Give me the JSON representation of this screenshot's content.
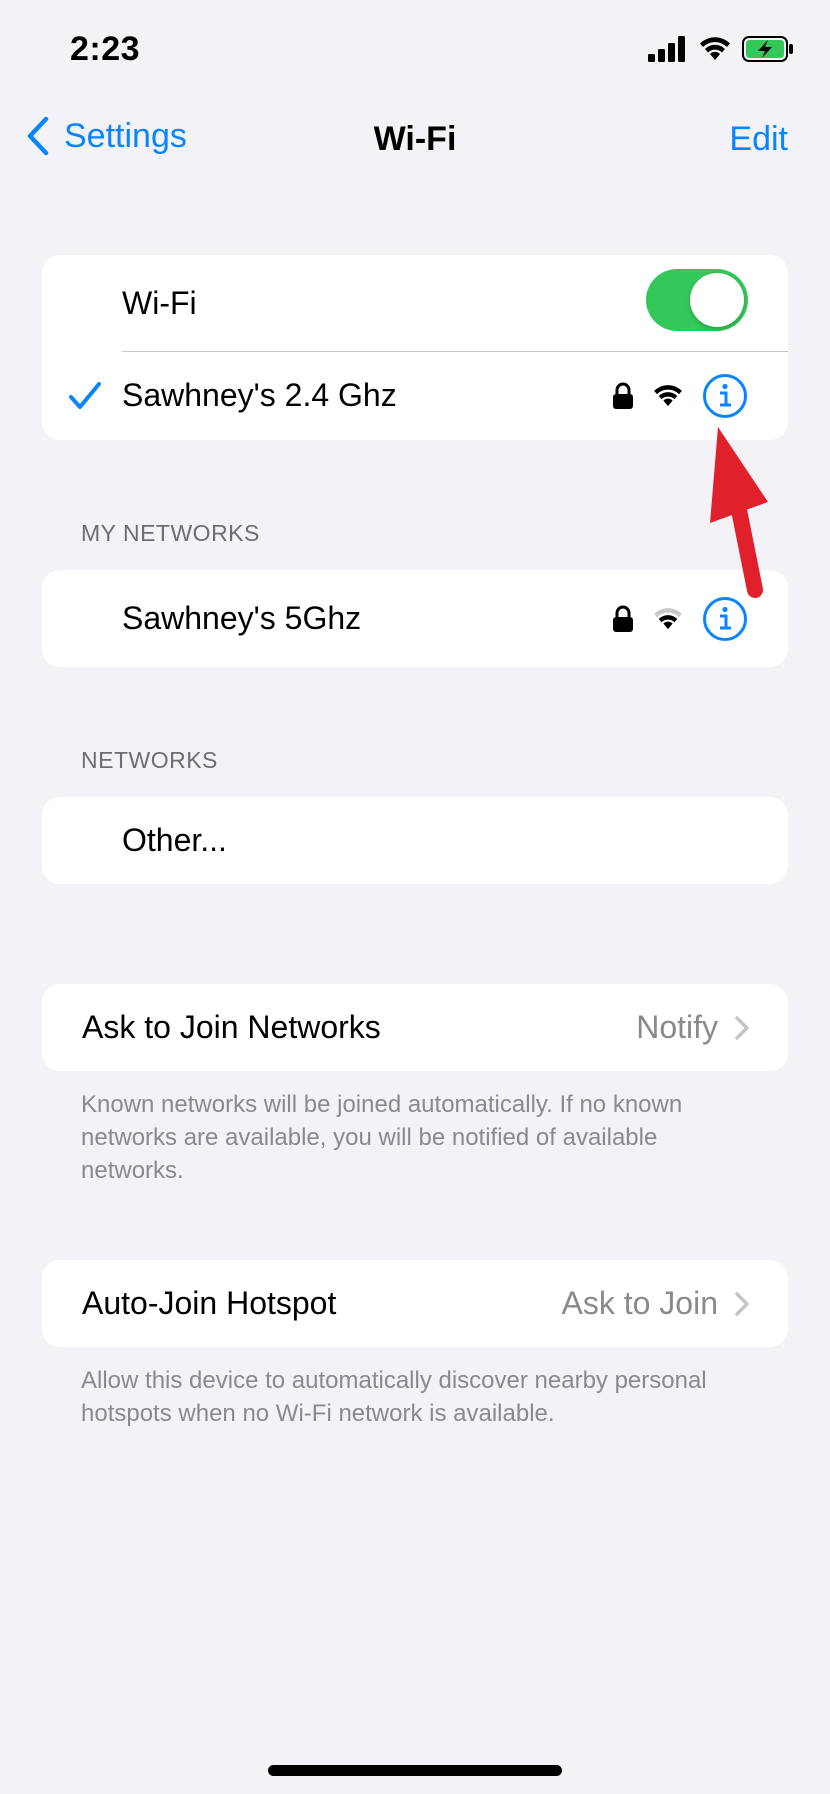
{
  "status_bar": {
    "time": "2:23"
  },
  "nav": {
    "back_label": "Settings",
    "title": "Wi-Fi",
    "edit_label": "Edit"
  },
  "wifi_toggle": {
    "label": "Wi-Fi",
    "on": true
  },
  "connected_network": {
    "name": "Sawhney's 2.4 Ghz"
  },
  "my_networks": {
    "header": "MY NETWORKS",
    "items": [
      {
        "name": "Sawhney's 5Ghz"
      }
    ]
  },
  "networks": {
    "header": "NETWORKS",
    "other_label": "Other..."
  },
  "ask_to_join": {
    "label": "Ask to Join Networks",
    "value": "Notify",
    "footnote": "Known networks will be joined automatically. If no known networks are available, you will be notified of available networks."
  },
  "auto_join_hotspot": {
    "label": "Auto-Join Hotspot",
    "value": "Ask to Join",
    "footnote": "Allow this device to automatically discover nearby personal hotspots when no Wi-Fi network is available."
  },
  "colors": {
    "accent": "#0a84ff",
    "toggle_on": "#34c759",
    "annotation": "#e0202a"
  }
}
